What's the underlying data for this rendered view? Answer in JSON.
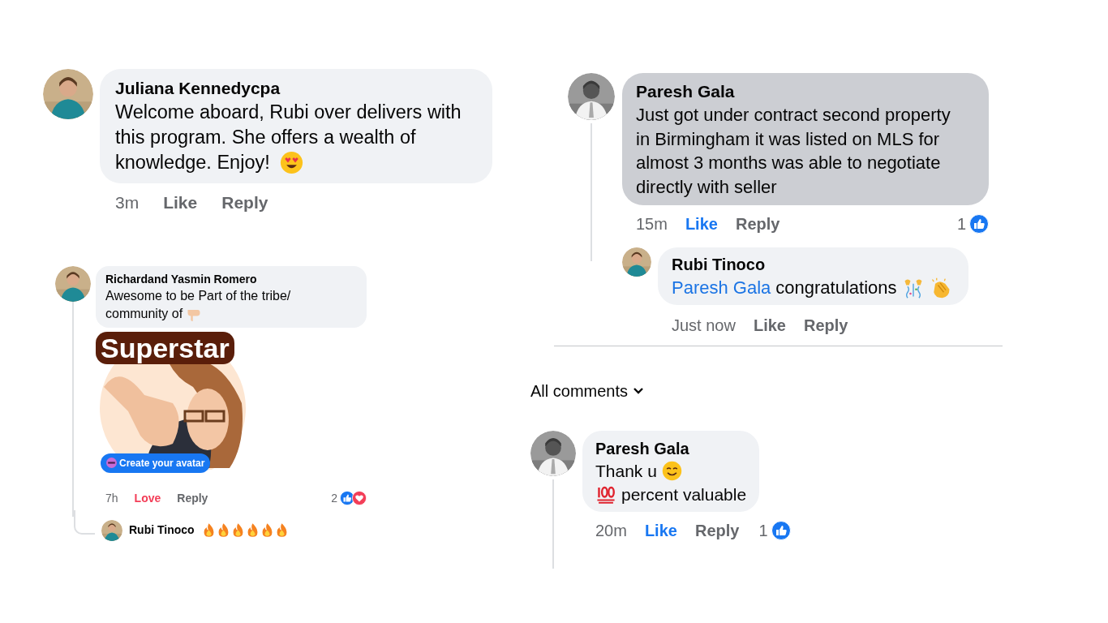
{
  "left_panel": {
    "comment": {
      "author": "Juliana Kennedycpa",
      "lines": [
        "Welcome aboard, Rubi over delivers with",
        "this program. She offers a wealth of",
        "knowledge. Enjoy!"
      ],
      "time": "3m",
      "like": "Like",
      "reacted": false,
      "reply": "Reply"
    },
    "second_comment": {
      "author": "Richardand Yasmin Romero",
      "lines": [
        "Awesome to be Part of the tribe/",
        "community of"
      ],
      "sticker_caption": "Superstar",
      "avatar_button": "Create your avatar",
      "time": "7h",
      "like": "Love",
      "reacted": true,
      "color": "#f33e58",
      "reply": "Reply",
      "reaction_count": "2",
      "reply_item": {
        "author": "Rubi Tinoco"
      }
    }
  },
  "right_panel": {
    "comment": {
      "author": "Paresh Gala",
      "text": "Just got under contract second property in Birmingham it was listed on MLS for almost 3 months was able to negotiate directly with seller",
      "highlighted": true,
      "time": "15m",
      "like": "Like",
      "reacted": true,
      "color": "#1877f2",
      "reply": "Reply",
      "reaction_count": "1",
      "reply_item": {
        "author": "Rubi Tinoco",
        "mention": "Paresh Gala",
        "text": "congratulations",
        "time": "Just now",
        "like": "Like",
        "reacted": false,
        "reply": "Reply"
      }
    },
    "sort_menu": {
      "label": "All comments"
    },
    "second_comment": {
      "author": "Paresh Gala",
      "line_1": "Thank u",
      "line_2": "percent valuable",
      "highlighted": false,
      "time": "20m",
      "like": "Like",
      "reacted": true,
      "color": "#1877f2",
      "reply": "Reply",
      "reaction_count": "1"
    }
  }
}
